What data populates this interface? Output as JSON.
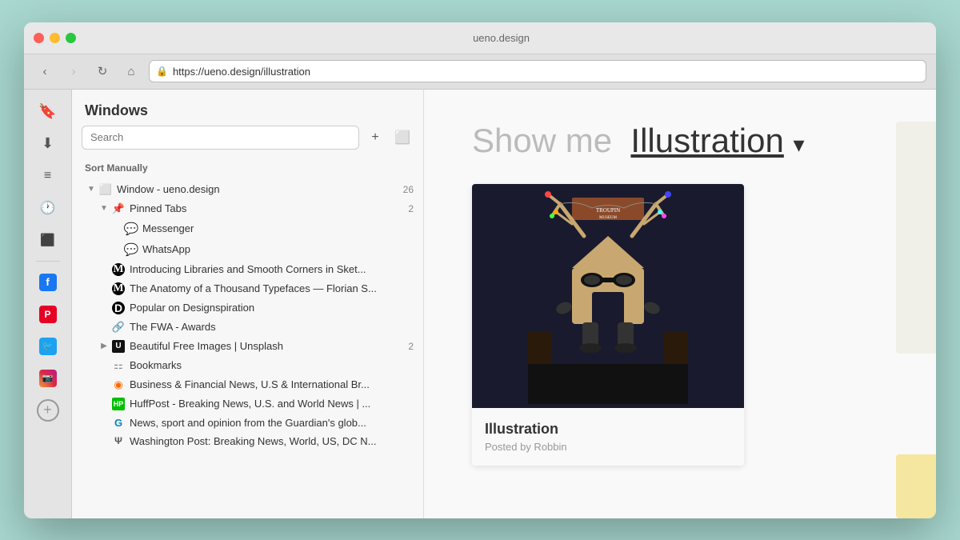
{
  "browser": {
    "title": "ueno.design",
    "url": "https://ueno.design/illustration",
    "back_disabled": false,
    "forward_disabled": true
  },
  "sidebar_icons": [
    {
      "name": "bookmark",
      "icon": "🔖",
      "label": "Bookmarks"
    },
    {
      "name": "download",
      "icon": "⬇",
      "label": "Downloads"
    },
    {
      "name": "reading-list",
      "icon": "📋",
      "label": "Reading List"
    },
    {
      "name": "history",
      "icon": "🕐",
      "label": "History"
    },
    {
      "name": "tabs",
      "icon": "⬛",
      "label": "Tab Overview"
    }
  ],
  "app_icons": [
    {
      "name": "facebook",
      "label": "Facebook"
    },
    {
      "name": "pinterest",
      "label": "Pinterest"
    },
    {
      "name": "twitter",
      "label": "Twitter"
    },
    {
      "name": "instagram",
      "label": "Instagram"
    }
  ],
  "windows_panel": {
    "title": "Windows",
    "search_placeholder": "Search",
    "sort_label": "Sort Manually",
    "add_button": "+",
    "new_tab_button": "⬜"
  },
  "tree": {
    "items": [
      {
        "id": "window-root",
        "indent": 0,
        "chevron": "▼",
        "icon": "window",
        "label": "Window - ueno.design",
        "count": "26",
        "expanded": true
      },
      {
        "id": "pinned-tabs",
        "indent": 1,
        "chevron": "▼",
        "icon": "pin",
        "label": "Pinned Tabs",
        "count": "2",
        "expanded": true
      },
      {
        "id": "messenger",
        "indent": 2,
        "chevron": "",
        "icon": "messenger",
        "label": "Messenger",
        "count": ""
      },
      {
        "id": "whatsapp",
        "indent": 2,
        "chevron": "",
        "icon": "whatsapp",
        "label": "WhatsApp",
        "count": ""
      },
      {
        "id": "sketch-libraries",
        "indent": 1,
        "chevron": "",
        "icon": "medium",
        "label": "Introducing Libraries and Smooth Corners in Sket...",
        "count": ""
      },
      {
        "id": "anatomy-typefaces",
        "indent": 1,
        "chevron": "",
        "icon": "medium",
        "label": "The Anatomy of a Thousand Typefaces — Florian S...",
        "count": ""
      },
      {
        "id": "designspiration",
        "indent": 1,
        "chevron": "",
        "icon": "designspiration",
        "label": "Popular on Designspiration",
        "count": ""
      },
      {
        "id": "fwa",
        "indent": 1,
        "chevron": "",
        "icon": "fwa",
        "label": "The FWA - Awards",
        "count": ""
      },
      {
        "id": "unsplash",
        "indent": 1,
        "chevron": "▶",
        "icon": "unsplash",
        "label": "Beautiful Free Images | Unsplash",
        "count": "2"
      },
      {
        "id": "bookmarks",
        "indent": 1,
        "chevron": "",
        "icon": "bookmarks",
        "label": "Bookmarks",
        "count": ""
      },
      {
        "id": "business",
        "indent": 1,
        "chevron": "",
        "icon": "business",
        "label": "Business & Financial News, U.S & International Br...",
        "count": ""
      },
      {
        "id": "huffpost",
        "indent": 1,
        "chevron": "",
        "icon": "huffpost",
        "label": "HuffPost - Breaking News, U.S. and World News | ...",
        "count": ""
      },
      {
        "id": "guardian",
        "indent": 1,
        "chevron": "",
        "icon": "guardian",
        "label": "News, sport and opinion from the Guardian's glob...",
        "count": ""
      },
      {
        "id": "wapo",
        "indent": 1,
        "chevron": "",
        "icon": "wapo",
        "label": "Washington Post: Breaking News, World, US, DC N...",
        "count": ""
      }
    ]
  },
  "web": {
    "heading_static": "Show me",
    "heading_highlight": "Illustration",
    "heading_arrow": "▾",
    "card": {
      "title": "Illustration",
      "subtitle": "Posted by Robbin"
    }
  }
}
